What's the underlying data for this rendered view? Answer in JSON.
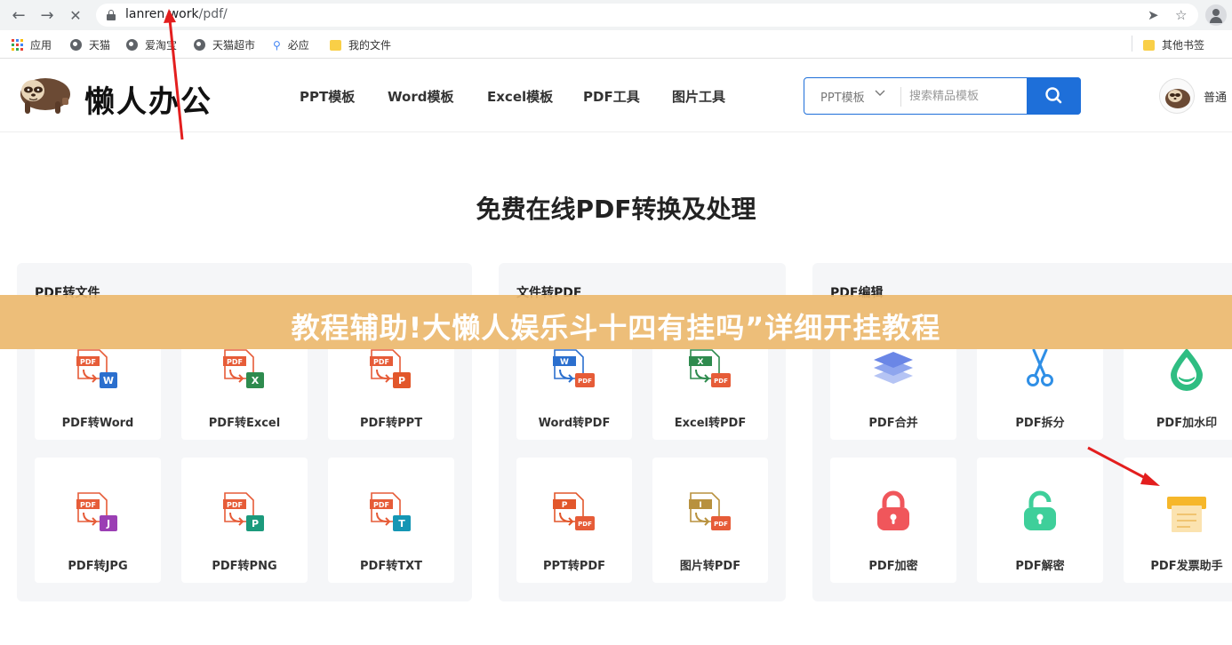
{
  "browser": {
    "url_host": "lanren.work",
    "url_path": "/pdf/",
    "bookmarks": [
      {
        "label": "应用",
        "icon": "apps-icon"
      },
      {
        "label": "天猫",
        "icon": "globe-icon"
      },
      {
        "label": "爱淘宝",
        "icon": "globe-icon"
      },
      {
        "label": "天猫超市",
        "icon": "globe-icon"
      },
      {
        "label": "必应",
        "icon": "search-icon"
      },
      {
        "label": "我的文件",
        "icon": "folder-icon"
      }
    ],
    "other_bookmarks": "其他书签"
  },
  "header": {
    "logo_text": "懒人办公",
    "nav": [
      "PPT模板",
      "Word模板",
      "Excel模板",
      "PDF工具",
      "图片工具"
    ],
    "search_category": "PPT模板",
    "search_placeholder": "搜索精品模板",
    "user_label": "普通"
  },
  "main": {
    "title": "免费在线PDF转换及处理",
    "panels": [
      {
        "title": "PDF转文件",
        "tools": [
          {
            "label": "PDF转Word",
            "icon": "pdf-to-word-icon"
          },
          {
            "label": "PDF转Excel",
            "icon": "pdf-to-excel-icon"
          },
          {
            "label": "PDF转PPT",
            "icon": "pdf-to-ppt-icon"
          },
          {
            "label": "PDF转JPG",
            "icon": "pdf-to-jpg-icon"
          },
          {
            "label": "PDF转PNG",
            "icon": "pdf-to-png-icon"
          },
          {
            "label": "PDF转TXT",
            "icon": "pdf-to-txt-icon"
          }
        ]
      },
      {
        "title": "文件转PDF",
        "tools": [
          {
            "label": "Word转PDF",
            "icon": "word-to-pdf-icon"
          },
          {
            "label": "Excel转PDF",
            "icon": "excel-to-pdf-icon"
          },
          {
            "label": "PPT转PDF",
            "icon": "ppt-to-pdf-icon"
          },
          {
            "label": "图片转PDF",
            "icon": "image-to-pdf-icon"
          }
        ]
      },
      {
        "title": "PDF编辑",
        "tools": [
          {
            "label": "PDF合并",
            "icon": "merge-layers-icon"
          },
          {
            "label": "PDF拆分",
            "icon": "scissors-icon"
          },
          {
            "label": "PDF加水印",
            "icon": "watermark-drop-icon"
          },
          {
            "label": "PDF加密",
            "icon": "lock-icon"
          },
          {
            "label": "PDF解密",
            "icon": "unlock-icon"
          },
          {
            "label": "PDF发票助手",
            "icon": "invoice-printer-icon"
          }
        ]
      }
    ]
  },
  "overlay_banner": "教程辅助!大懒人娱乐斗十四有挂吗”详细开挂教程",
  "colors": {
    "brand_blue": "#1e6fd9",
    "pdf_red": "#e65c38",
    "word_blue": "#2b6fce",
    "excel_green": "#2e8b4e",
    "ppt_orange": "#e2572b",
    "jpg_purple": "#9b3fb4",
    "png_teal": "#1c9a7c",
    "txt_teal": "#1596b4",
    "image_gold": "#b8913e",
    "banner": "#ecb86e",
    "annotation_red": "#e31e1e"
  }
}
